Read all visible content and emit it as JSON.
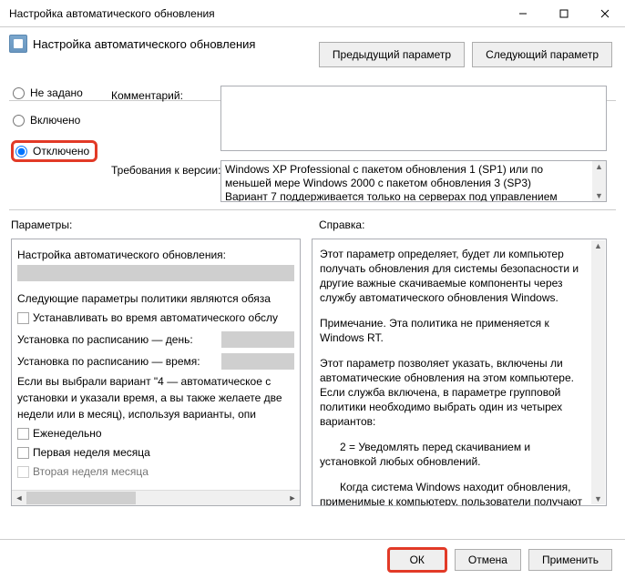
{
  "window": {
    "title": "Настройка автоматического обновления",
    "subtitle": "Настройка автоматического обновления"
  },
  "nav": {
    "prev": "Предыдущий параметр",
    "next": "Следующий параметр"
  },
  "radios": {
    "not_configured": "Не задано",
    "enabled": "Включено",
    "disabled": "Отключено"
  },
  "labels": {
    "comment": "Комментарий:",
    "requirements": "Требования к версии:",
    "parameters": "Параметры:",
    "help": "Справка:"
  },
  "requirements_text": "Windows XP Professional с пакетом обновления 1 (SP1) или по меньшей мере Windows 2000 с пакетом обновления 3 (SP3)\nВариант 7 поддерживается только на серверах под управлением",
  "params": {
    "heading": "Настройка автоматического обновления:",
    "subheading": "Следующие параметры политики являются обяза",
    "chk_install_maint": "Устанавливать во время автоматического обслу",
    "sched_day": "Установка по расписанию — день:",
    "sched_time": "Установка по расписанию — время:",
    "paragraph": "Если вы выбрали вариант \"4 — автоматическое с установки и указали время, а вы также желаете две недели или в месяц), используя варианты, опи",
    "chk_weekly": "Еженедельно",
    "chk_first_week": "Первая неделя месяца",
    "chk_second_week": "Вторая неделя месяца"
  },
  "help": {
    "p1": "Этот параметр определяет, будет ли компьютер получать обновления для системы безопасности и другие важные скачиваемые компоненты через службу автоматического обновления Windows.",
    "p2": "Примечание. Эта политика не применяется к Windows RT.",
    "p3": "Этот параметр позволяет указать, включены ли автоматические обновления на этом компьютере. Если служба включена, в параметре групповой политики необходимо выбрать один из четырех вариантов:",
    "p4": "2 = Уведомлять перед скачиванием и установкой любых обновлений.",
    "p5": "Когда система Windows находит обновления, применимые к компьютеру, пользователи получают уведомления о готовности обновлений к скачиванию. После перехода в Центр обновления Windows пользователи могут скачать и установить все доступные обновления."
  },
  "buttons": {
    "ok": "ОК",
    "cancel": "Отмена",
    "apply": "Применить"
  }
}
